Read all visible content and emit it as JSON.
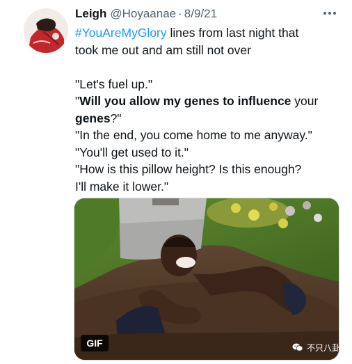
{
  "tweet": {
    "display_name": "Leigh",
    "handle": "@Hoyaanae",
    "separator": "·",
    "date": "8/9/21",
    "hashtag": "#YouAreMyGlory",
    "intro_rest": " lines from last night that",
    "intro_line2": "took me out and am still not over",
    "quote1": "\"Let's fuel up.\"",
    "quote2_open": "\"",
    "quote2_bold1": "Will you allow my genes to influence",
    "quote2_mid": " your",
    "quote2_bold2": "genes",
    "quote2_end": "?\"",
    "quote3": "\"In the end, you come home to me anyway.\"",
    "quote4": "\"You'll get used to it.\"",
    "quote5a": "\"How is this pillow height? Is this enough?",
    "quote5b": "I'll make it lower.\""
  },
  "media": {
    "badge": "GIF",
    "watermark": "不只八卦"
  },
  "icons": {
    "more": "more-options-icon",
    "watermark": "wechat-icon"
  },
  "colors": {
    "hashtag": "#1d9bf0",
    "text": "#0f1419",
    "secondary": "#536471"
  }
}
